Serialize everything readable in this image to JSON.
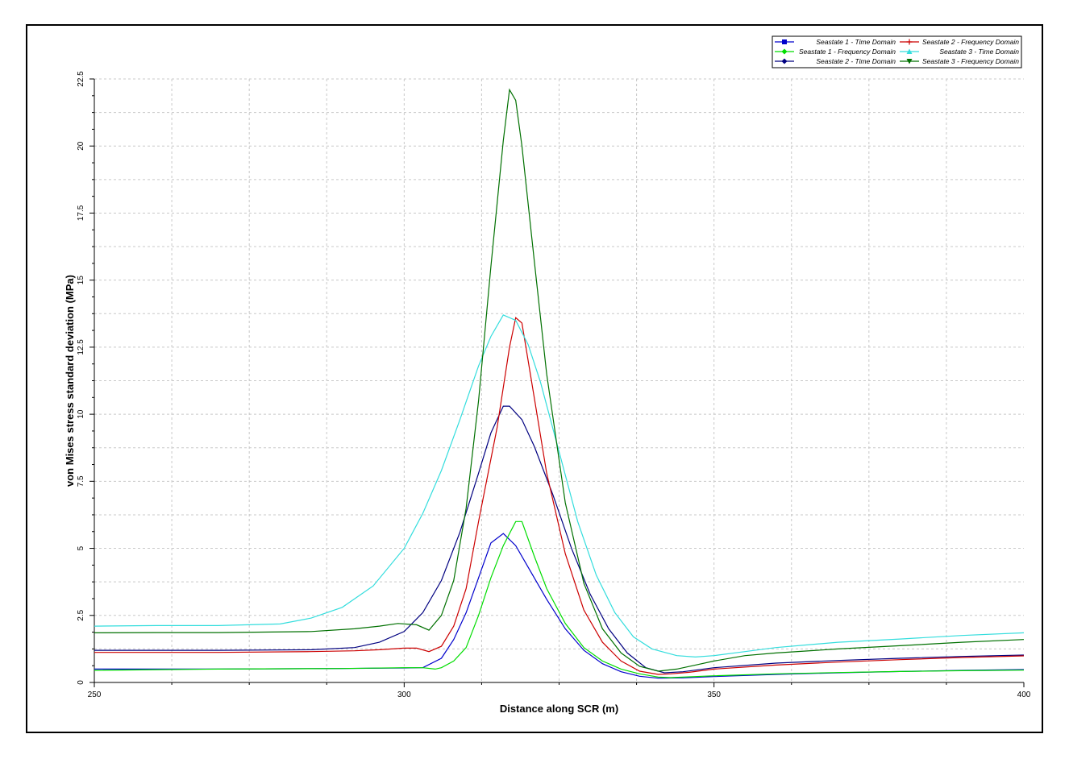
{
  "chart_data": {
    "type": "line",
    "title": "",
    "xlabel": "Distance along SCR (m)",
    "ylabel": "von Mises stress standard deviation (MPa)",
    "xlim": [
      250,
      400
    ],
    "ylim": [
      0,
      22.5
    ],
    "x_ticks": [
      250,
      300,
      350,
      400
    ],
    "y_ticks": [
      0,
      2.5,
      5,
      7.5,
      10,
      12.5,
      15,
      17.5,
      20,
      22.5
    ],
    "x_tick_labels": [
      "250",
      "300",
      "350",
      "400"
    ],
    "y_tick_labels": [
      "0",
      "2.5",
      "5",
      "7.5",
      "10",
      "12.5",
      "15",
      "17.5",
      "20",
      "22.5"
    ],
    "grid": true,
    "legend_position": "top-right",
    "series": [
      {
        "name": "Seastate 1 - Time Domain",
        "color": "#0000cc",
        "marker": "square",
        "points": [
          [
            250,
            0.5
          ],
          [
            270,
            0.5
          ],
          [
            290,
            0.52
          ],
          [
            300,
            0.54
          ],
          [
            303,
            0.55
          ],
          [
            306,
            0.9
          ],
          [
            308,
            1.6
          ],
          [
            310,
            2.6
          ],
          [
            312,
            3.9
          ],
          [
            314,
            5.2
          ],
          [
            316,
            5.55
          ],
          [
            318,
            5.1
          ],
          [
            320,
            4.3
          ],
          [
            323,
            3.1
          ],
          [
            326,
            2.0
          ],
          [
            329,
            1.2
          ],
          [
            332,
            0.7
          ],
          [
            335,
            0.4
          ],
          [
            338,
            0.23
          ],
          [
            341,
            0.16
          ],
          [
            345,
            0.17
          ],
          [
            350,
            0.22
          ],
          [
            360,
            0.3
          ],
          [
            370,
            0.36
          ],
          [
            380,
            0.41
          ],
          [
            390,
            0.45
          ],
          [
            400,
            0.48
          ]
        ]
      },
      {
        "name": "Seastate 1 - Frequency Domain",
        "color": "#00dd00",
        "marker": "diamond",
        "points": [
          [
            250,
            0.45
          ],
          [
            270,
            0.5
          ],
          [
            290,
            0.52
          ],
          [
            300,
            0.55
          ],
          [
            303,
            0.55
          ],
          [
            305,
            0.5
          ],
          [
            306,
            0.55
          ],
          [
            308,
            0.8
          ],
          [
            310,
            1.3
          ],
          [
            312,
            2.5
          ],
          [
            314,
            3.9
          ],
          [
            316,
            5.1
          ],
          [
            318,
            6.0
          ],
          [
            319,
            6.0
          ],
          [
            321,
            4.7
          ],
          [
            323,
            3.5
          ],
          [
            326,
            2.2
          ],
          [
            329,
            1.3
          ],
          [
            332,
            0.8
          ],
          [
            335,
            0.5
          ],
          [
            338,
            0.32
          ],
          [
            341,
            0.2
          ],
          [
            343,
            0.18
          ],
          [
            350,
            0.25
          ],
          [
            360,
            0.32
          ],
          [
            370,
            0.37
          ],
          [
            380,
            0.41
          ],
          [
            390,
            0.44
          ],
          [
            400,
            0.46
          ]
        ]
      },
      {
        "name": "Seastate 2 - Time Domain",
        "color": "#000080",
        "marker": "diamond",
        "points": [
          [
            250,
            1.2
          ],
          [
            270,
            1.2
          ],
          [
            285,
            1.22
          ],
          [
            292,
            1.3
          ],
          [
            296,
            1.5
          ],
          [
            300,
            1.9
          ],
          [
            303,
            2.6
          ],
          [
            306,
            3.8
          ],
          [
            309,
            5.6
          ],
          [
            312,
            7.8
          ],
          [
            314,
            9.3
          ],
          [
            316,
            10.3
          ],
          [
            317,
            10.3
          ],
          [
            319,
            9.8
          ],
          [
            321,
            8.8
          ],
          [
            324,
            7.0
          ],
          [
            327,
            5.0
          ],
          [
            330,
            3.3
          ],
          [
            333,
            2.0
          ],
          [
            336,
            1.1
          ],
          [
            339,
            0.55
          ],
          [
            342,
            0.36
          ],
          [
            345,
            0.4
          ],
          [
            350,
            0.55
          ],
          [
            360,
            0.72
          ],
          [
            370,
            0.82
          ],
          [
            380,
            0.9
          ],
          [
            390,
            0.97
          ],
          [
            400,
            1.02
          ]
        ]
      },
      {
        "name": "Seastate 2 - Frequency Domain",
        "color": "#cc0000",
        "marker": "plus",
        "points": [
          [
            250,
            1.12
          ],
          [
            270,
            1.12
          ],
          [
            285,
            1.15
          ],
          [
            292,
            1.18
          ],
          [
            296,
            1.22
          ],
          [
            300,
            1.28
          ],
          [
            302,
            1.28
          ],
          [
            304,
            1.15
          ],
          [
            306,
            1.35
          ],
          [
            308,
            2.1
          ],
          [
            310,
            3.5
          ],
          [
            312,
            6.0
          ],
          [
            315,
            9.5
          ],
          [
            317,
            12.5
          ],
          [
            318,
            13.6
          ],
          [
            319,
            13.4
          ],
          [
            321,
            10.6
          ],
          [
            323,
            7.8
          ],
          [
            326,
            4.8
          ],
          [
            329,
            2.7
          ],
          [
            332,
            1.5
          ],
          [
            335,
            0.8
          ],
          [
            338,
            0.42
          ],
          [
            341,
            0.3
          ],
          [
            343,
            0.32
          ],
          [
            346,
            0.38
          ],
          [
            350,
            0.5
          ],
          [
            360,
            0.65
          ],
          [
            370,
            0.76
          ],
          [
            380,
            0.85
          ],
          [
            390,
            0.93
          ],
          [
            400,
            0.99
          ]
        ]
      },
      {
        "name": "Seastate 3 - Time Domain",
        "color": "#33dddd",
        "marker": "triangle",
        "points": [
          [
            250,
            2.1
          ],
          [
            260,
            2.12
          ],
          [
            270,
            2.12
          ],
          [
            280,
            2.18
          ],
          [
            285,
            2.4
          ],
          [
            290,
            2.8
          ],
          [
            295,
            3.6
          ],
          [
            300,
            5.0
          ],
          [
            303,
            6.3
          ],
          [
            306,
            7.9
          ],
          [
            309,
            9.8
          ],
          [
            312,
            11.8
          ],
          [
            314,
            12.9
          ],
          [
            316,
            13.7
          ],
          [
            318,
            13.5
          ],
          [
            320,
            12.6
          ],
          [
            322,
            11.2
          ],
          [
            325,
            8.6
          ],
          [
            328,
            6.0
          ],
          [
            331,
            4.0
          ],
          [
            334,
            2.6
          ],
          [
            337,
            1.7
          ],
          [
            340,
            1.25
          ],
          [
            344,
            1.0
          ],
          [
            347,
            0.95
          ],
          [
            350,
            1.0
          ],
          [
            355,
            1.15
          ],
          [
            360,
            1.3
          ],
          [
            370,
            1.5
          ],
          [
            380,
            1.62
          ],
          [
            390,
            1.75
          ],
          [
            400,
            1.85
          ]
        ]
      },
      {
        "name": "Seastate 3 - Frequency Domain",
        "color": "#007000",
        "marker": "triangle-down",
        "points": [
          [
            250,
            1.85
          ],
          [
            260,
            1.86
          ],
          [
            270,
            1.86
          ],
          [
            285,
            1.9
          ],
          [
            292,
            2.0
          ],
          [
            296,
            2.1
          ],
          [
            299,
            2.2
          ],
          [
            302,
            2.15
          ],
          [
            304,
            1.95
          ],
          [
            306,
            2.5
          ],
          [
            308,
            3.8
          ],
          [
            310,
            6.5
          ],
          [
            312,
            10.5
          ],
          [
            314,
            15.5
          ],
          [
            316,
            20.2
          ],
          [
            317,
            22.1
          ],
          [
            318,
            21.7
          ],
          [
            319,
            20.0
          ],
          [
            321,
            15.7
          ],
          [
            323,
            11.5
          ],
          [
            326,
            6.7
          ],
          [
            329,
            3.7
          ],
          [
            332,
            2.0
          ],
          [
            335,
            1.1
          ],
          [
            338,
            0.6
          ],
          [
            341,
            0.42
          ],
          [
            344,
            0.5
          ],
          [
            347,
            0.65
          ],
          [
            350,
            0.8
          ],
          [
            355,
            1.0
          ],
          [
            360,
            1.1
          ],
          [
            370,
            1.25
          ],
          [
            380,
            1.37
          ],
          [
            390,
            1.5
          ],
          [
            400,
            1.6
          ]
        ]
      }
    ]
  }
}
